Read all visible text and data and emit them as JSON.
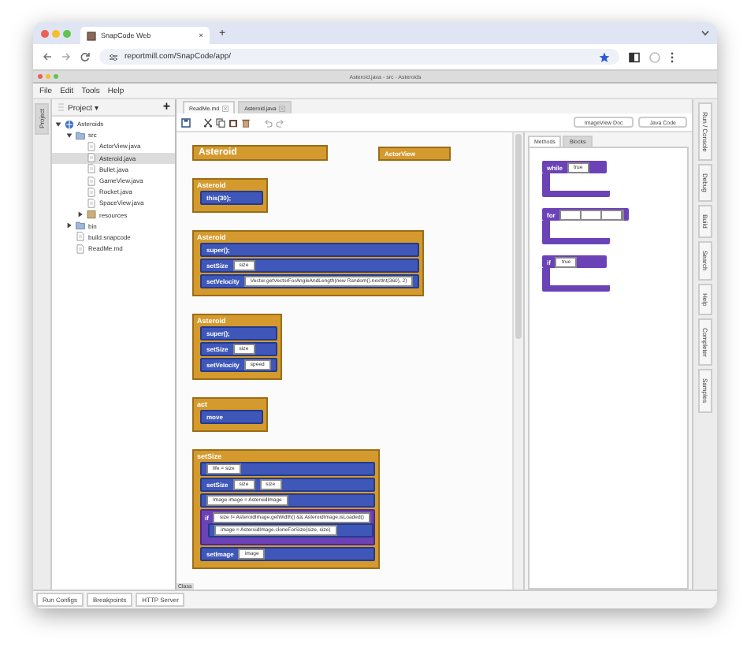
{
  "browser": {
    "tab_title": "SnapCode Web",
    "tab_close": "×",
    "new_tab": "+",
    "url": "reportmill.com/SnapCode/app/"
  },
  "window": {
    "title": "Asteroid.java - src - Asteroids"
  },
  "menu": [
    "File",
    "Edit",
    "Tools",
    "Help"
  ],
  "left_tabs": [
    {
      "label": "Project",
      "selected": true
    }
  ],
  "project": {
    "title": "Project ▾",
    "add": "+",
    "tree": [
      {
        "label": "Asteroids",
        "kind": "project",
        "expanded": true,
        "selected": false,
        "children": [
          {
            "label": "src",
            "kind": "folder",
            "expanded": true,
            "selected": false,
            "children": [
              {
                "label": "ActorView.java",
                "kind": "file",
                "selected": false
              },
              {
                "label": "Asteroid.java",
                "kind": "file",
                "selected": true
              },
              {
                "label": "Bullet.java",
                "kind": "file",
                "selected": false
              },
              {
                "label": "GameView.java",
                "kind": "file",
                "selected": false
              },
              {
                "label": "Rocket.java",
                "kind": "file",
                "selected": false
              },
              {
                "label": "SpaceView.java",
                "kind": "file",
                "selected": false
              },
              {
                "label": "resources",
                "kind": "package",
                "expanded": false,
                "selected": false
              }
            ]
          },
          {
            "label": "bin",
            "kind": "folder",
            "expanded": false,
            "selected": false
          },
          {
            "label": "build.snapcode",
            "kind": "file",
            "selected": false
          },
          {
            "label": "ReadMe.md",
            "kind": "file",
            "selected": false
          }
        ]
      }
    ]
  },
  "editor_tabs": [
    {
      "label": "ReadMe.md",
      "selected": false
    },
    {
      "label": "Asteroid.java",
      "selected": true
    }
  ],
  "doc_buttons": [
    "ImageView Doc",
    "Java Code"
  ],
  "class_header": {
    "name": "Asteroid",
    "extends": "ActorView"
  },
  "blocks": [
    {
      "title": "Asteroid",
      "statements": [
        {
          "kind": "call",
          "label": "this(30);"
        }
      ]
    },
    {
      "title": "Asteroid",
      "statements": [
        {
          "kind": "call",
          "label": "super();"
        },
        {
          "kind": "call",
          "label": "setSize",
          "args": [
            "size"
          ]
        },
        {
          "kind": "call",
          "label": "setVelocity",
          "args": [
            "Vector.getVectorForAngleAndLength(new Random().nextInt(360), 2)"
          ]
        }
      ]
    },
    {
      "title": "Asteroid",
      "statements": [
        {
          "kind": "call",
          "label": "super();"
        },
        {
          "kind": "call",
          "label": "setSize",
          "args": [
            "size"
          ]
        },
        {
          "kind": "call",
          "label": "setVelocity",
          "args": [
            "speed"
          ]
        }
      ]
    },
    {
      "title": "act",
      "statements": [
        {
          "kind": "call",
          "label": "move"
        }
      ]
    },
    {
      "title": "setSize",
      "statements": [
        {
          "kind": "expr",
          "args": [
            "life = size"
          ]
        },
        {
          "kind": "call",
          "label": "setSize",
          "args": [
            "size",
            "size"
          ]
        },
        {
          "kind": "expr",
          "args": [
            "Image image = AsteroidImage"
          ]
        },
        {
          "kind": "if",
          "label": "if",
          "args": [
            "size != AsteroidImage.getWidth() && AsteroidImage.isLoaded()"
          ],
          "children": [
            {
              "kind": "expr",
              "args": [
                "image = AsteroidImage.cloneForSize(size, size)"
              ]
            }
          ]
        },
        {
          "kind": "call",
          "label": "setImage",
          "args": [
            "image"
          ]
        }
      ]
    }
  ],
  "canvas_label": "Class",
  "palette_tabs": [
    {
      "label": "Methods",
      "selected": false
    },
    {
      "label": "Blocks",
      "selected": true
    }
  ],
  "palette": [
    {
      "kind": "while",
      "label": "while",
      "value": "true"
    },
    {
      "kind": "for",
      "label": "for"
    },
    {
      "kind": "if",
      "label": "if",
      "value": "true"
    }
  ],
  "right_tabs": [
    "Run / Console",
    "Debug",
    "Build",
    "Search",
    "Help",
    "Completer",
    "Samples"
  ],
  "bottom_tabs": [
    "Run Configs",
    "Breakpoints",
    "HTTP Server"
  ]
}
